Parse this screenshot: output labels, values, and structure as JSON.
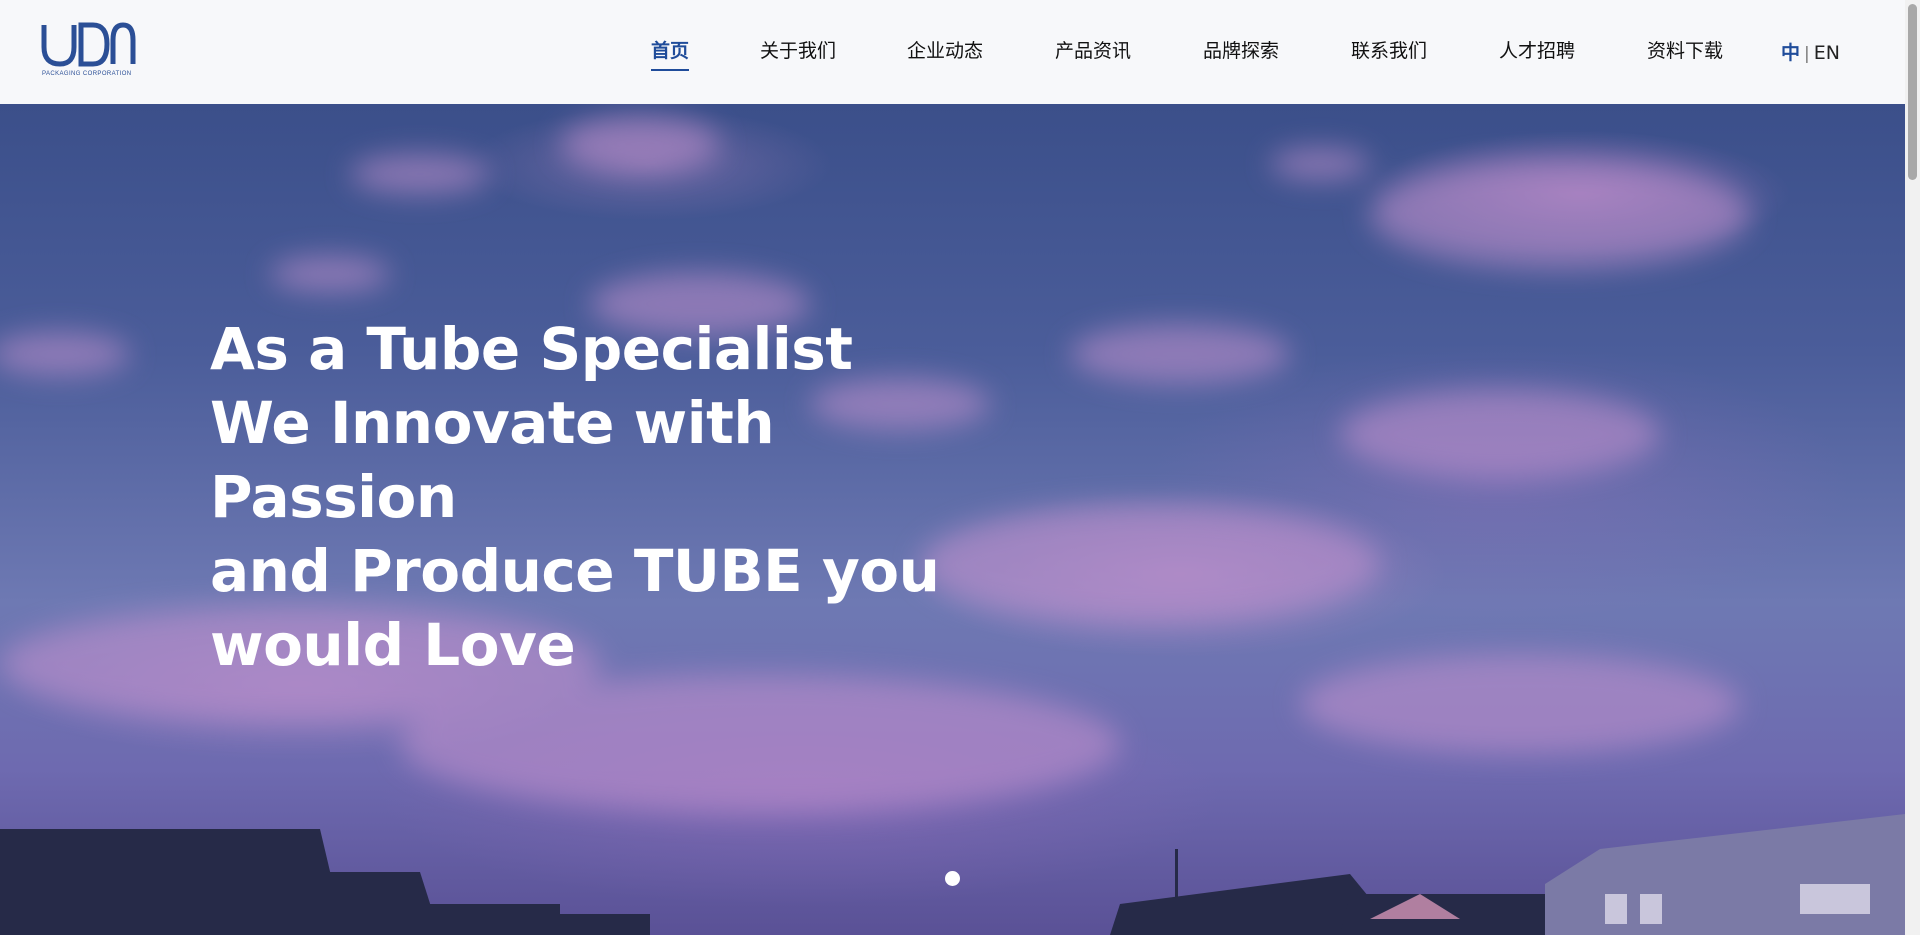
{
  "header": {
    "logo_text": "UDN",
    "logo_caption": "PACKAGING CORPORATION",
    "nav": [
      {
        "label": "首页",
        "active": true
      },
      {
        "label": "关于我们"
      },
      {
        "label": "企业动态"
      },
      {
        "label": "产品资讯"
      },
      {
        "label": "品牌探索"
      },
      {
        "label": "联系我们"
      },
      {
        "label": "人才招聘"
      },
      {
        "label": "资料下载"
      }
    ],
    "lang": {
      "zh": "中",
      "separator": "|",
      "en": "EN"
    }
  },
  "hero": {
    "lines": [
      "As a Tube Specialist",
      "We Innovate with",
      "Passion",
      "and Produce TUBE you",
      "would Love"
    ],
    "slide_dots": 1
  },
  "colors": {
    "brand": "#1f4c9a",
    "header_bg": "#f7f8fa",
    "hero_text": "#ffffff"
  }
}
